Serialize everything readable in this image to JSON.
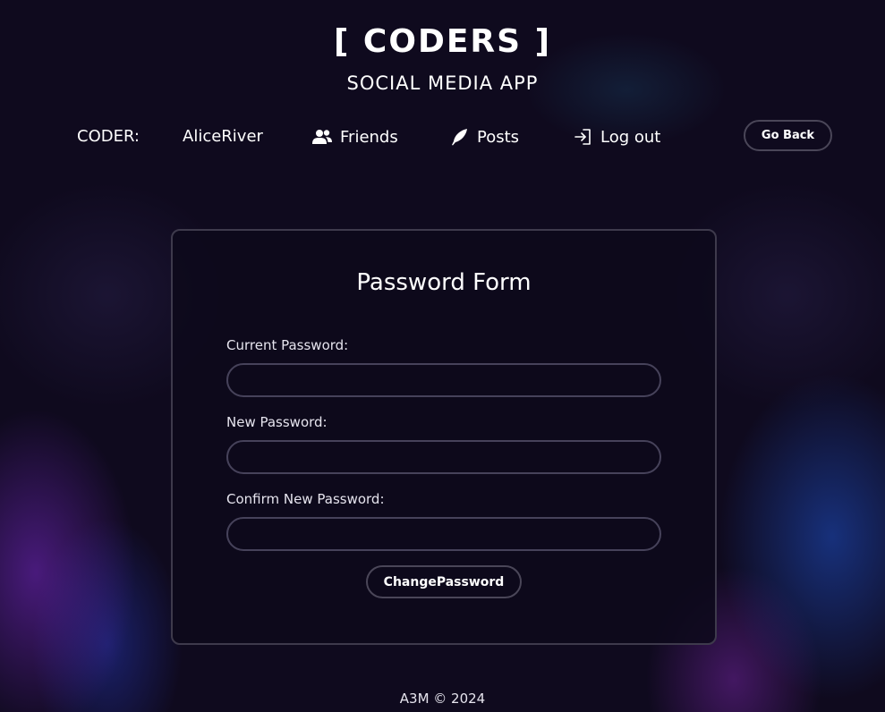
{
  "header": {
    "title": "[ CODERS ]",
    "subtitle": "SOCIAL MEDIA APP"
  },
  "nav": {
    "coder_label": "CODER:",
    "username": "AliceRiver",
    "friends_label": "Friends",
    "posts_label": "Posts",
    "logout_label": "Log out",
    "go_back_label": "Go Back"
  },
  "form": {
    "title": "Password Form",
    "current_password": {
      "label": "Current Password:",
      "value": ""
    },
    "new_password": {
      "label": "New Password:",
      "value": ""
    },
    "confirm_password": {
      "label": "Confirm New Password:",
      "value": ""
    },
    "submit_label": "ChangePassword"
  },
  "footer": {
    "text": "A3M © 2024"
  },
  "colors": {
    "background": "#0f0a1e",
    "border": "#46425a",
    "text": "#ffffff"
  },
  "icons": {
    "friends": "users-icon",
    "posts": "feather-icon",
    "logout": "logout-icon"
  }
}
